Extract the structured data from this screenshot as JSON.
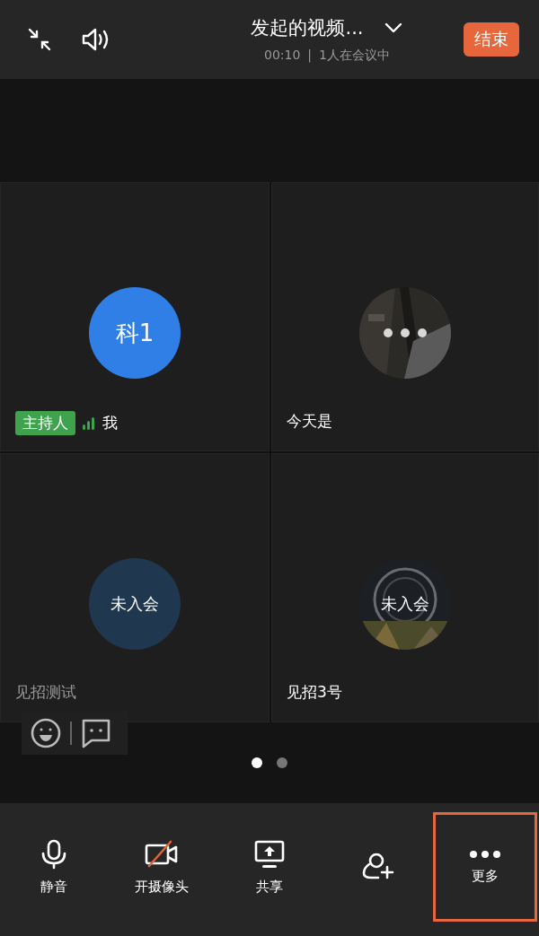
{
  "header": {
    "title": "发起的视频...",
    "duration": "00:10",
    "separator": "|",
    "participants": "1人在会议中",
    "end_button": "结束"
  },
  "tiles": [
    {
      "avatar": {
        "kind": "initials",
        "text": "科1",
        "color": "#2f7fe6"
      },
      "host_badge": "主持人",
      "signal": true,
      "name": "我",
      "dimmed": false
    },
    {
      "avatar": {
        "kind": "photo_loading"
      },
      "signal": false,
      "name": "今天是",
      "dimmed": false
    },
    {
      "avatar": {
        "kind": "initials",
        "text": "未入会",
        "color": "#1f3850"
      },
      "signal": false,
      "name": "见招测试",
      "dimmed": true
    },
    {
      "avatar": {
        "text": "未入会"
      },
      "signal": false,
      "name": "见招3号",
      "dimmed": false
    }
  ],
  "pages": [
    {
      "selected": true
    },
    {
      "selected": false
    }
  ],
  "toolbar": [
    {
      "kind": "mic",
      "label": "静音",
      "highlighted": false
    },
    {
      "kind": "camera_off",
      "label": "开摄像头",
      "highlighted": false
    },
    {
      "kind": "share",
      "label": "共享",
      "highlighted": false
    },
    {
      "kind": "invite",
      "highlighted": false
    },
    {
      "kind": "more",
      "label": "更多",
      "highlighted": true
    }
  ]
}
